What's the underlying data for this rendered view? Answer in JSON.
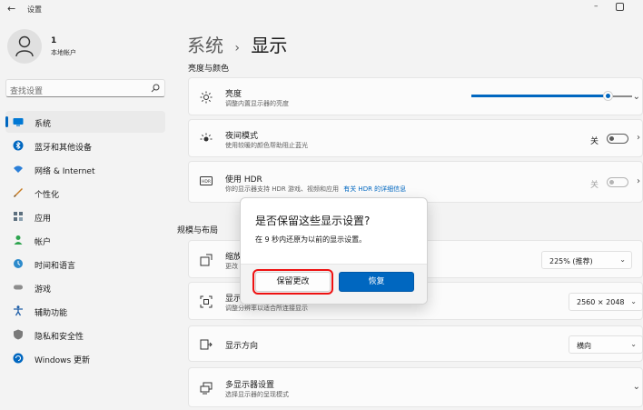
{
  "window": {
    "title": "设置",
    "back_glyph": "←",
    "minimize_glyph": "–"
  },
  "user": {
    "name": "1",
    "account_type": "本地帐户"
  },
  "search": {
    "placeholder": "查找设置"
  },
  "sidebar": {
    "items": [
      {
        "label": "系统",
        "icon": "monitor-icon",
        "color": "#0078d4",
        "active": true
      },
      {
        "label": "蓝牙和其他设备",
        "icon": "bluetooth-icon",
        "color": "#0067c0"
      },
      {
        "label": "网络 & Internet",
        "icon": "wifi-icon",
        "color": "#2b7fd8"
      },
      {
        "label": "个性化",
        "icon": "brush-icon",
        "color": "#c87a1f"
      },
      {
        "label": "应用",
        "icon": "apps-icon",
        "color": "#5c6f7e"
      },
      {
        "label": "帐户",
        "icon": "person-icon",
        "color": "#2ea44f"
      },
      {
        "label": "时间和语言",
        "icon": "globe-clock-icon",
        "color": "#2c8acb"
      },
      {
        "label": "游戏",
        "icon": "gamepad-icon",
        "color": "#8c8c8c"
      },
      {
        "label": "辅助功能",
        "icon": "accessibility-icon",
        "color": "#1f5fa8"
      },
      {
        "label": "隐私和安全性",
        "icon": "shield-icon",
        "color": "#7a7a7a"
      },
      {
        "label": "Windows 更新",
        "icon": "update-icon",
        "color": "#0067c0"
      }
    ]
  },
  "main": {
    "breadcrumb_parent": "系统",
    "breadcrumb_separator": "›",
    "breadcrumb_current": "显示",
    "section_brightness": "亮度与颜色",
    "section_layout": "规模与布局",
    "brightness": {
      "title": "亮度",
      "subtitle": "调整内置显示器的亮度",
      "level": 0.85
    },
    "night_light": {
      "title": "夜间模式",
      "subtitle": "使用较暖的颜色帮助阻止蓝光",
      "state": "关"
    },
    "hdr": {
      "title": "使用 HDR",
      "subtitle": "你的显示器支持 HDR 游戏、视频和应用",
      "link": "有关 HDR 的详细信息",
      "state": "关"
    },
    "scale": {
      "title": "缩放",
      "subtitle": "更改",
      "value": "225% (推荐)"
    },
    "resolution": {
      "title": "显示",
      "subtitle": "调整分辨率以适合所连接显示",
      "value": "2560 × 2048"
    },
    "orientation": {
      "title": "显示方向",
      "value": "横向"
    },
    "multi_display": {
      "title": "多显示器设置",
      "subtitle": "选择显示器的呈现模式"
    }
  },
  "dialog": {
    "title": "是否保留这些显示设置?",
    "message": "在 9 秒内还原为以前的显示设置。",
    "keep_label": "保留更改",
    "revert_label": "恢复"
  },
  "colors": {
    "accent": "#0067c0",
    "highlight_box": "#e11111"
  }
}
